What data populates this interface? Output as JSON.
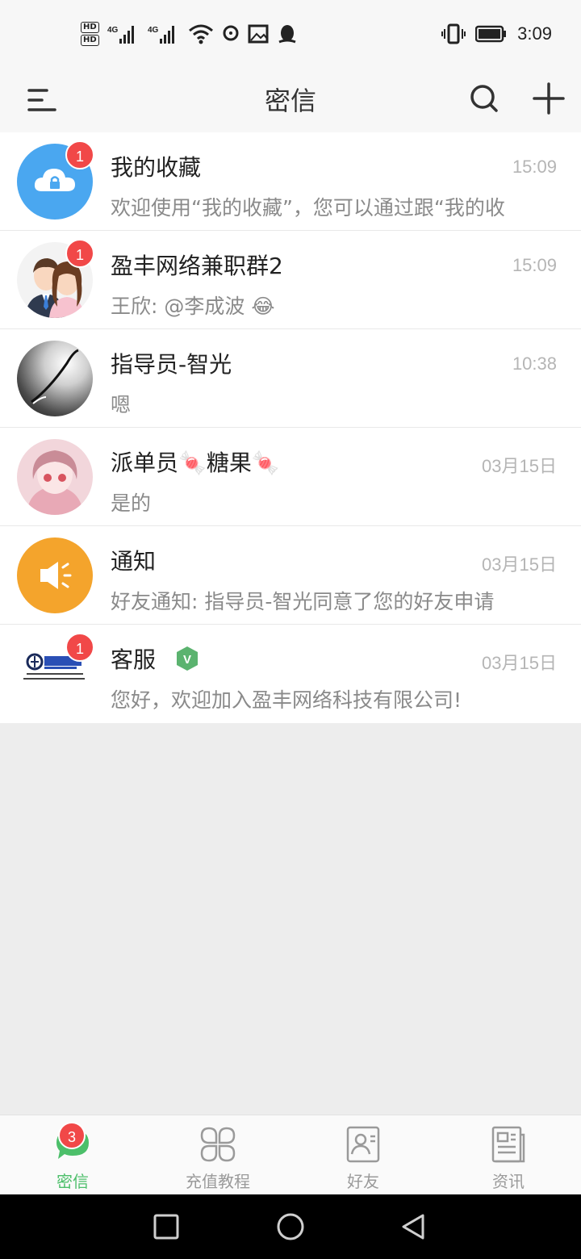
{
  "status_bar": {
    "hd1": "HD",
    "hd2": "HD",
    "net1": "4G",
    "net2": "4G",
    "time": "3:09"
  },
  "header": {
    "title": "密信"
  },
  "conversations": [
    {
      "name": "我的收藏",
      "time": "15:09",
      "preview": "欢迎使用“我的收藏”，您可以通过跟“我的收",
      "badge": "1"
    },
    {
      "name": "盈丰网络兼职群2",
      "time": "15:09",
      "preview": "王欣: @李成波 😂",
      "badge": "1"
    },
    {
      "name": "指导员-智光",
      "time": "10:38",
      "preview": "嗯",
      "badge": ""
    },
    {
      "name": "派单员🍬糖果🍬",
      "time": "03月15日",
      "preview": "是的",
      "badge": ""
    },
    {
      "name": "通知",
      "time": "03月15日",
      "preview": "好友通知: 指导员-智光同意了您的好友申请",
      "badge": ""
    },
    {
      "name": "客服",
      "time": "03月15日",
      "preview": "您好，欢迎加入盈丰网络科技有限公司!",
      "badge": "1",
      "verified_label": "V"
    }
  ],
  "tabs": [
    {
      "label": "密信",
      "badge": "3",
      "active": true
    },
    {
      "label": "充值教程"
    },
    {
      "label": "好友"
    },
    {
      "label": "资讯"
    }
  ],
  "colors": {
    "accent": "#4cbf6a",
    "badge": "#f14848",
    "favorites_avatar": "#4aa7f0",
    "notice_avatar": "#f4a42c",
    "verified": "#5bb36f"
  },
  "icons": {
    "menu": "menu-icon",
    "search": "search-icon",
    "add": "plus-icon"
  }
}
